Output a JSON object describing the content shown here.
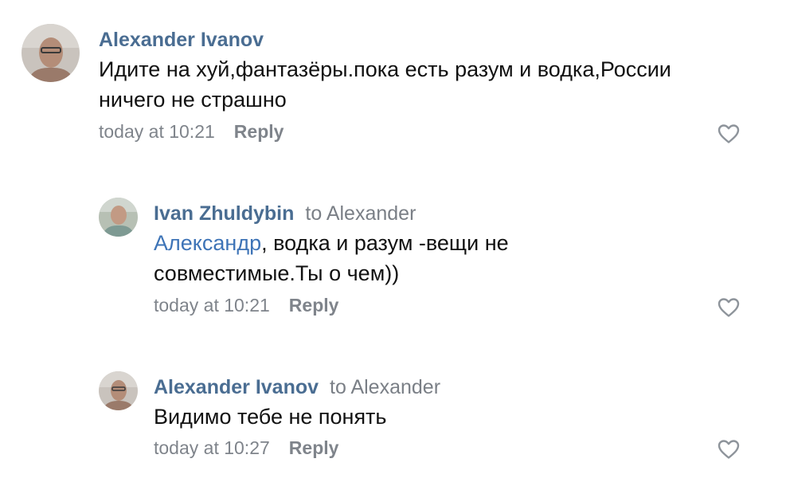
{
  "comments": [
    {
      "author": "Alexander Ivanov",
      "text_line1": "Идите на хуй,фантазёры.пока есть разум и водка,России",
      "text_line2": "ничего не страшно",
      "time": "today at 10:21",
      "reply": "Reply",
      "avatar_icon": "user-avatar-photo",
      "like_icon": "heart-outline-icon"
    },
    {
      "author": "Ivan Zhuldybin",
      "to": "to Alexander",
      "mention": "Александр",
      "text_line1_rest": ", водка и разум -вещи не",
      "text_line2": "совместимые.Ты о чем))",
      "time": "today at 10:21",
      "reply": "Reply",
      "avatar_icon": "user-avatar-photo",
      "like_icon": "heart-outline-icon"
    },
    {
      "author": "Alexander Ivanov",
      "to": "to Alexander",
      "text_line1": "Видимо тебе не понять",
      "time": "today at 10:27",
      "reply": "Reply",
      "avatar_icon": "user-avatar-photo",
      "like_icon": "heart-outline-icon"
    }
  ],
  "colors": {
    "author_name": "#4a6d92",
    "mention": "#3e74b7",
    "meta_text": "#7f848b",
    "body_text": "#111111",
    "like_icon": "#8e949b"
  }
}
